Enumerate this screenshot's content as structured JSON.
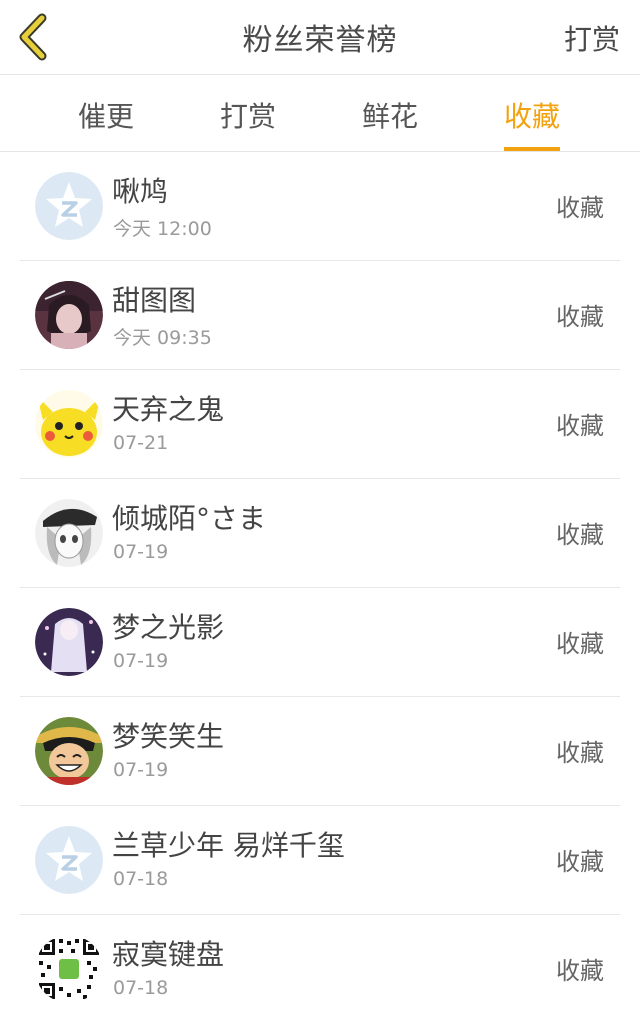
{
  "header": {
    "title": "粉丝荣誉榜",
    "right_label": "打赏"
  },
  "tabs": [
    {
      "label": "催更",
      "active": false
    },
    {
      "label": "打赏",
      "active": false
    },
    {
      "label": "鲜花",
      "active": false
    },
    {
      "label": "收藏",
      "active": true
    }
  ],
  "colors": {
    "accent": "#f2a20f",
    "back_icon": "#e6cf3a"
  },
  "fans": [
    {
      "name": "啾鸠",
      "time": "今天 12:00",
      "action": "收藏",
      "avatar": "qq-default-avatar"
    },
    {
      "name": "甜图图",
      "time": "今天 09:35",
      "action": "收藏",
      "avatar": "anime-girl-avatar"
    },
    {
      "name": "天弃之鬼",
      "time": "07-21",
      "action": "收藏",
      "avatar": "pikachu-avatar"
    },
    {
      "name": "倾城陌°さま",
      "time": "07-19",
      "action": "收藏",
      "avatar": "manga-girl-avatar"
    },
    {
      "name": "梦之光影",
      "time": "07-19",
      "action": "收藏",
      "avatar": "fantasy-girl-avatar"
    },
    {
      "name": "梦笑笑生",
      "time": "07-19",
      "action": "收藏",
      "avatar": "luffy-avatar"
    },
    {
      "name": "兰草少年 易烊千玺",
      "time": "07-18",
      "action": "收藏",
      "avatar": "qq-default-avatar"
    },
    {
      "name": "寂寞键盘",
      "time": "07-18",
      "action": "收藏",
      "avatar": "qr-code-avatar"
    }
  ]
}
